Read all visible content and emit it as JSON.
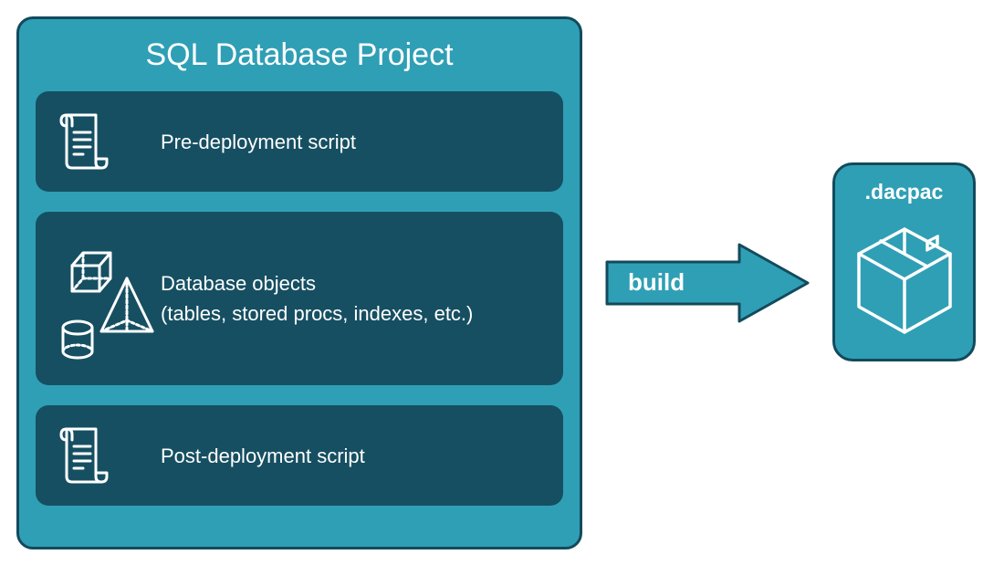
{
  "project": {
    "title": "SQL Database Project",
    "sections": {
      "pre": {
        "label": "Pre-deployment script"
      },
      "objects": {
        "label_line1": "Database objects",
        "label_line2": "(tables, stored procs, indexes, etc.)"
      },
      "post": {
        "label": "Post-deployment script"
      }
    }
  },
  "arrow": {
    "label": "build"
  },
  "output": {
    "label": ".dacpac"
  },
  "colors": {
    "outer_bg": "#2f9fb5",
    "inner_bg": "#164f62",
    "border": "#134a5c",
    "text": "#ffffff"
  }
}
